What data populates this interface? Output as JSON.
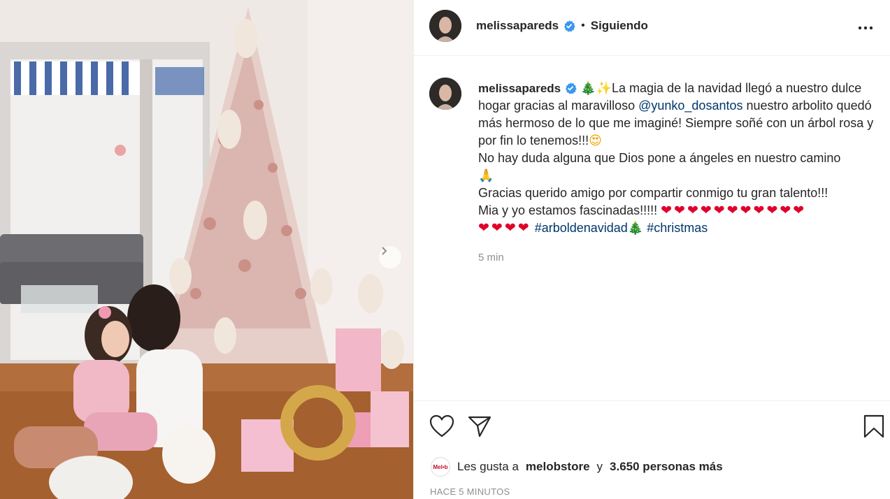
{
  "post": {
    "username": "melissapareds",
    "follow_status": "Siguiendo",
    "more_label": "•••"
  },
  "caption": {
    "username": "melissapareds",
    "line1_text": "La magia de la navidad llegó a nuestro dulce hogar gracias al maravilloso ",
    "mention": "@yunko_dosantos",
    "line1_rest": " nuestro arbolito quedó más hermoso de lo que me imaginé! Siempre soñé con un árbol rosa y por fin lo tenemos!!!",
    "line2_text": "No hay duda alguna que Dios pone a ángeles en nuestro camino",
    "line3_text": "Gracias querido amigo por compartir conmigo tu gran talento!!!",
    "line4_text": "Mia y yo estamos fascinadas!!!!! ",
    "hearts_a": "❤❤❤❤❤❤❤❤❤❤❤",
    "hearts_b": "❤❤❤❤",
    "hashtag1": "#arboldenavidad",
    "hashtag2": "#christmas",
    "time": "5 min"
  },
  "likes": {
    "mini_logo_text": "Mel•b",
    "prefix": "Les gusta a",
    "user": "melobstore",
    "conj": "y",
    "others": "3.650 personas más"
  },
  "timestamp": "HACE 5 MINUTOS",
  "icons": {
    "verified": "verified-badge-icon",
    "like": "heart-icon",
    "share": "paper-plane-icon",
    "save": "bookmark-icon",
    "next": "chevron-right-icon",
    "more": "more-horizontal-icon"
  },
  "colors": {
    "verified_blue": "#3897f0",
    "link_blue": "#00376b",
    "muted": "#8e8e8e"
  }
}
